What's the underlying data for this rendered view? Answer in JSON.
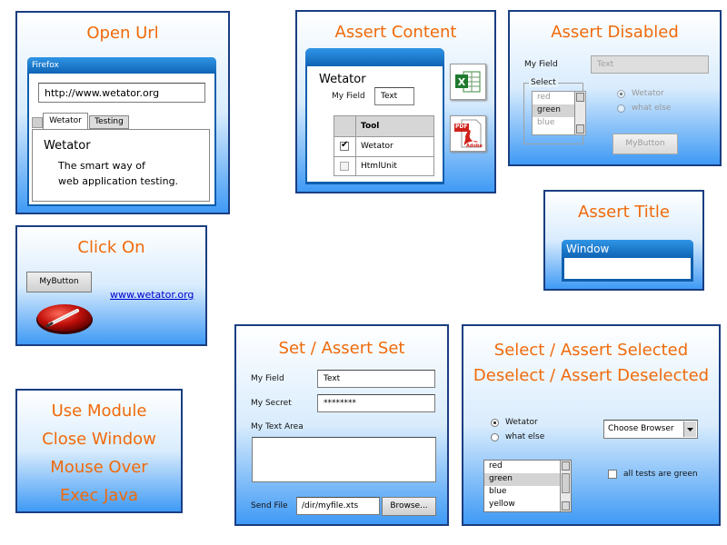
{
  "open_url": {
    "title": "Open Url",
    "browser_label": "Firefox",
    "url_value": "http://www.wetator.org",
    "tabs": [
      "Wetator",
      "Testing"
    ],
    "heading": "Wetator",
    "line1": "The smart way of",
    "line2": "web application testing."
  },
  "assert_content": {
    "title": "Assert Content",
    "heading": "Wetator",
    "field_label": "My Field",
    "field_value": "Text",
    "table_header": "Tool",
    "rows": [
      {
        "label": "Wetator",
        "checked": true
      },
      {
        "label": "HtmlUnit",
        "checked": false
      }
    ],
    "excel_icon": "excel-icon",
    "pdf_icon": "pdf-icon",
    "pdf_text": "PDF",
    "adobe_text": "Adobe"
  },
  "assert_disabled": {
    "title": "Assert Disabled",
    "field_label": "My Field",
    "field_value": "Text",
    "group_label": "Select",
    "options": [
      "red",
      "green",
      "blue"
    ],
    "selected_index": 1,
    "radios": [
      "Wetator",
      "what else"
    ],
    "button_label": "MyButton"
  },
  "assert_title": {
    "title": "Assert Title",
    "window_label": "Window"
  },
  "click_on": {
    "title": "Click On",
    "button_label": "MyButton",
    "link_text": "www.wetator.org"
  },
  "set_assert": {
    "title": "Set / Assert Set",
    "field_label": "My Field",
    "field_value": "Text",
    "secret_label": "My Secret",
    "secret_value": "********",
    "textarea_label": "My Text Area",
    "file_label": "Send File",
    "file_value": "/dir/myfile.xts",
    "browse_label": "Browse..."
  },
  "select_card": {
    "title1": "Select / Assert Selected",
    "title2": "Deselect / Assert Deselected",
    "radios": [
      "Wetator",
      "what else"
    ],
    "dropdown_value": "Choose Browser",
    "list_options": [
      "red",
      "green",
      "blue",
      "yellow"
    ],
    "selected_index": 1,
    "checkbox_label": "all tests are green"
  },
  "misc": {
    "lines": [
      "Use Module",
      "Close Window",
      "Mouse Over",
      "Exec Java"
    ]
  },
  "colors": {
    "title_orange": "#f06a0a",
    "card_border": "#1a3e82",
    "window_blue": "#1478c8",
    "link_blue": "#0000cc"
  }
}
